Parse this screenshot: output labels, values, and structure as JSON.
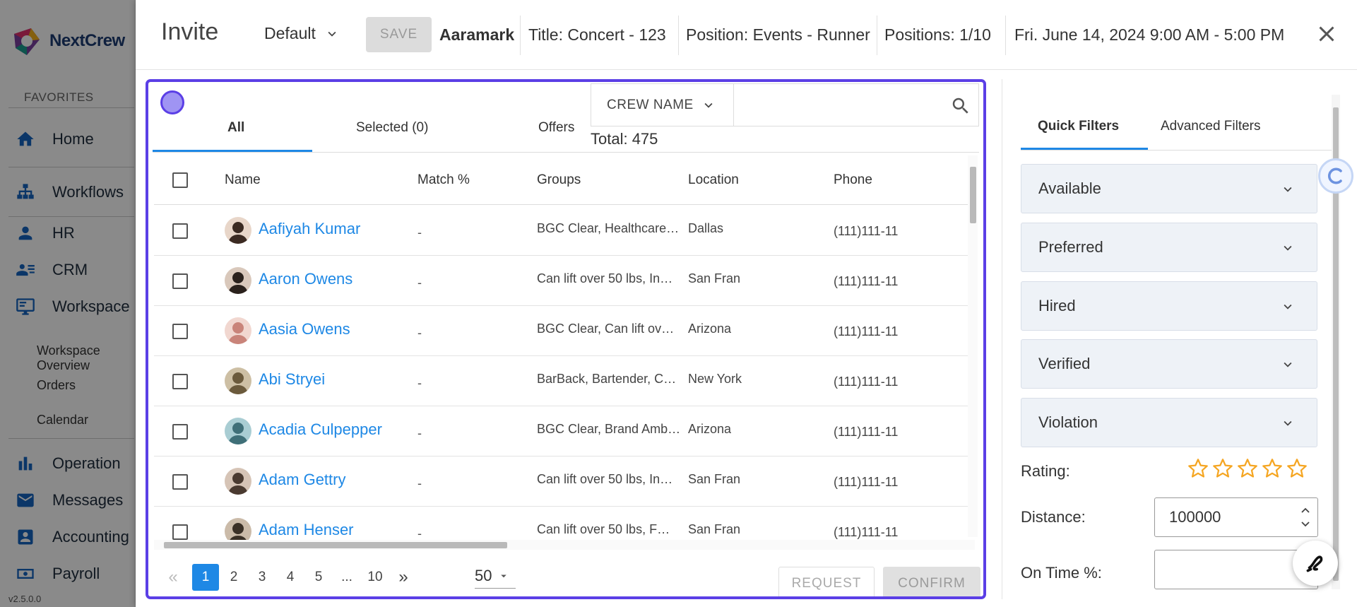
{
  "app": {
    "brand": "NextCrew",
    "version": "v2.5.0.0",
    "favorites_label": "FAVORITES",
    "nav": [
      {
        "label": "Home",
        "icon": "home-icon"
      },
      {
        "label": "Workflows",
        "icon": "workflow-icon"
      },
      {
        "label": "HR",
        "icon": "person-icon"
      },
      {
        "label": "CRM",
        "icon": "contacts-icon"
      },
      {
        "label": "Workspace",
        "icon": "monitor-icon"
      },
      {
        "label": "Operation",
        "icon": "bar-chart-icon"
      },
      {
        "label": "Messages",
        "icon": "mail-icon"
      },
      {
        "label": "Accounting",
        "icon": "accounting-icon"
      },
      {
        "label": "Payroll",
        "icon": "payroll-icon"
      }
    ],
    "sub_nav": [
      "Workspace Overview",
      "Orders",
      "Calendar"
    ]
  },
  "header": {
    "title": "Invite",
    "preset": "Default",
    "save_label": "SAVE",
    "client": "Aaramark",
    "job_title": "Title: Concert - 123",
    "position": "Position: Events - Runner",
    "positions_count": "Positions: 1/10",
    "datetime": "Fri. June 14, 2024 9:00 AM - 5:00 PM"
  },
  "crew": {
    "tabs": [
      "All",
      "Selected (0)",
      "Offers"
    ],
    "search_type": "CREW NAME",
    "search_placeholder": "",
    "total": "Total: 475",
    "columns": [
      "Name",
      "Match %",
      "Groups",
      "Location",
      "Phone"
    ],
    "rows": [
      {
        "name": "Aafiyah Kumar",
        "match": "-",
        "groups": "BGC Clear, Healthcare…",
        "location": "Dallas",
        "phone": "(111)111-11",
        "avatar_color": "#3b2a22"
      },
      {
        "name": "Aaron Owens",
        "match": "-",
        "groups": "Can lift over 50 lbs, In…",
        "location": "San Fran",
        "phone": "(111)111-11",
        "avatar_color": "#2a211c"
      },
      {
        "name": "Aasia Owens",
        "match": "-",
        "groups": "BGC Clear, Can lift ov…",
        "location": "Arizona",
        "phone": "(111)111-11",
        "avatar_color": "#c9847a"
      },
      {
        "name": "Abi Stryei",
        "match": "-",
        "groups": "BarBack, Bartender, C…",
        "location": "New York",
        "phone": "(111)111-11",
        "avatar_color": "#6b5a3c"
      },
      {
        "name": "Acadia Culpepper",
        "match": "-",
        "groups": "BGC Clear, Brand Amb…",
        "location": "Arizona",
        "phone": "(111)111-11",
        "avatar_color": "#3f6f78"
      },
      {
        "name": "Adam Gettry",
        "match": "-",
        "groups": "Can lift over 50 lbs, In…",
        "location": "San Fran",
        "phone": "(111)111-11",
        "avatar_color": "#4a3a30"
      },
      {
        "name": "Adam Henser",
        "match": "-",
        "groups": "Can lift over 50 lbs, F…",
        "location": "San Fran",
        "phone": "(111)111-11",
        "avatar_color": "#3a3026"
      }
    ],
    "pagination": {
      "pages": [
        "1",
        "2",
        "3",
        "4",
        "5",
        "...",
        "10"
      ],
      "current": "1",
      "page_size": "50"
    },
    "request_label": "REQUEST",
    "confirm_label": "CONFIRM"
  },
  "filters": {
    "tabs": [
      "Quick Filters",
      "Advanced Filters"
    ],
    "accordions": [
      "Available",
      "Preferred",
      "Hired",
      "Verified",
      "Violation"
    ],
    "rating_label": "Rating:",
    "rating_stars": 5,
    "distance_label": "Distance:",
    "distance_value": "100000",
    "ontime_label": "On Time %:"
  },
  "colors": {
    "accent": "#1e88e5",
    "panel_border": "#5b3fe6",
    "star": "#f5a623",
    "nav_icon": "#1565c0"
  }
}
